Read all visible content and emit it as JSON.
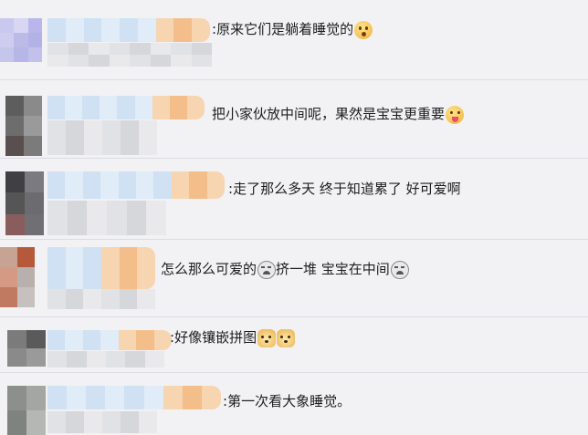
{
  "comments": [
    {
      "separator": ":",
      "text": "原来它们是躺着睡觉的",
      "emoji": [
        "surprised-face-icon"
      ]
    },
    {
      "separator": "",
      "text": "把小家伙放中间呢，果然是宝宝更重要",
      "emoji": [
        "tongue-out-face-icon"
      ]
    },
    {
      "separator": ":",
      "text": "走了那么多天 终于知道累了 好可爱啊",
      "emoji": []
    },
    {
      "separator": "",
      "text_parts": [
        "怎么那么可爱的",
        "挤一堆 宝宝在中间"
      ],
      "emoji": [
        "crying-face-icon",
        "crying-face-icon"
      ]
    },
    {
      "separator": ":",
      "text": "好像镶嵌拼图",
      "emoji": [
        "doge-icon",
        "doge-icon"
      ]
    },
    {
      "separator": ":",
      "text": "第一次看大象睡觉。",
      "emoji": []
    }
  ],
  "blur_palette": {
    "avatar": [
      [
        "#c9c9ef",
        "#d8d6f2",
        "#b8b6ea",
        "#cfcdef",
        "#bcbbe8",
        "#b3b1e6",
        "#c6c5ec",
        "#b7b6e9",
        "#c2c1eb"
      ],
      [
        "#5d5d5d",
        "#8a8a8a",
        "#6d6d6d",
        "#9a9a9a",
        "#5a4f4f",
        "#7b7b7b",
        "#a0a0a0",
        "#8c8c8c",
        "#b0b0b0"
      ],
      [
        "#3f3f44",
        "#7a7a80",
        "#555",
        "#6b6b70",
        "#8a5d5d",
        "#6f6f74",
        "#9a9a9e",
        "#7c7c80",
        "#a8a8ac"
      ],
      [
        "#c6a392",
        "#b6583a",
        "#d49a83",
        "#b8b0ac",
        "#c07a62",
        "#c6c1be",
        "#d4d0ce",
        "#b7b2af",
        "#cbc7c4"
      ],
      [
        "#7b7b7b",
        "#5a5a5a",
        "#8a8a8a",
        "#9a9a9a",
        "#6b6b6b",
        "#a8a8a8",
        "#8f8f8f",
        "#b5b5b5",
        "#9c9c9c"
      ],
      [
        "#8c8f8c",
        "#a3a6a3",
        "#7f837f",
        "#b4b7b4",
        "#999c99",
        "#c3c5c3",
        "#a9aba9",
        "#bcbebc",
        "#cfd0cf"
      ]
    ],
    "nick_main": "#cfe1f2",
    "nick_alt": "#e0ecf7",
    "nick_end": "#f6d5b0",
    "nick_end_alt": "#f3be8a",
    "sub": [
      "#e1e2e6",
      "#d6d7db",
      "#e9e9ec"
    ]
  }
}
